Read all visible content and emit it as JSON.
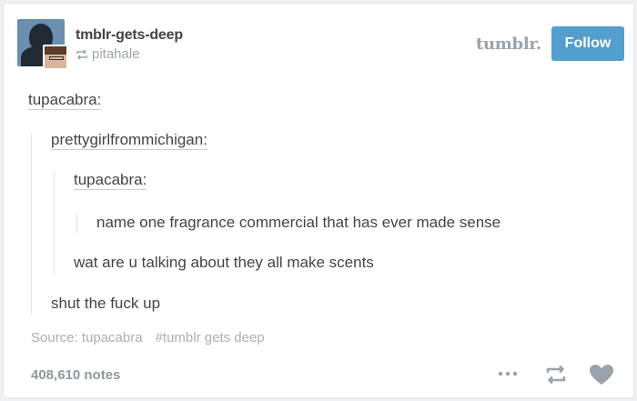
{
  "header": {
    "blog_name": "tmblr-gets-deep",
    "reblogged_from": "pitahale",
    "logo_text": "tumblr.",
    "follow_label": "Follow"
  },
  "thread": [
    {
      "user": "tupacabra:"
    },
    {
      "user": "prettygirlfrommichigan:"
    },
    {
      "user": "tupacabra:"
    },
    {
      "text": "name one fragrance commercial that has ever made sense"
    },
    {
      "text": "wat are u talking about they all make scents"
    },
    {
      "text": "shut the fuck up"
    }
  ],
  "footer": {
    "source_label": "Source: tupacabra",
    "tag": "#tumblr gets deep",
    "notes": "408,610 notes"
  },
  "icons": {
    "more": "more-dots-icon",
    "reblog": "reblog-icon",
    "like": "heart-icon"
  },
  "colors": {
    "follow_button": "#529ecc",
    "secondary_text": "#9da6ae"
  }
}
